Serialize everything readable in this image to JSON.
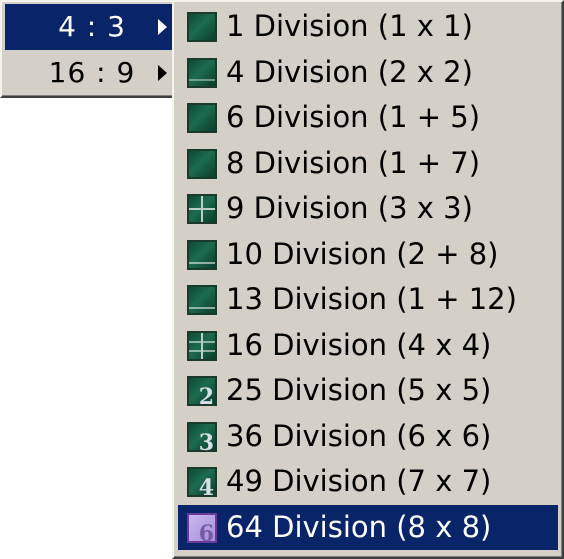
{
  "aspect_menu": {
    "items": [
      {
        "label": "4 : 3",
        "selected": true
      },
      {
        "label": "16 : 9",
        "selected": false
      }
    ]
  },
  "division_menu": {
    "items": [
      {
        "label": "1 Division (1 x 1)",
        "icon": "single-view-icon"
      },
      {
        "label": "4 Division (2 x 2)",
        "icon": "quad-view-icon"
      },
      {
        "label": "6 Division (1 + 5)",
        "icon": "six-view-icon"
      },
      {
        "label": "8 Division (1 + 7)",
        "icon": "eight-view-icon"
      },
      {
        "label": "9 Division (3 x 3)",
        "icon": "nine-grid-icon"
      },
      {
        "label": "10 Division (2 + 8)",
        "icon": "ten-view-icon"
      },
      {
        "label": "13 Division (1 + 12)",
        "icon": "thirteen-view-icon"
      },
      {
        "label": "16 Division (4 x 4)",
        "icon": "sixteen-grid-icon"
      },
      {
        "label": "25 Division (5 x 5)",
        "icon": "numbered-grid-2-icon",
        "icon_text": "2"
      },
      {
        "label": "36 Division (6 x 6)",
        "icon": "numbered-grid-3-icon",
        "icon_text": "3"
      },
      {
        "label": "49 Division (7 x 7)",
        "icon": "numbered-grid-4-icon",
        "icon_text": "4"
      },
      {
        "label": "64 Division (8 x 8)",
        "icon": "numbered-grid-6-icon",
        "icon_text": "6",
        "selected": true
      }
    ]
  },
  "colors": {
    "menu_bg": "#d4d0c8",
    "highlight": "#0a246a",
    "icon_green": "#1c6b4f",
    "icon_selected": "#a58fd9"
  }
}
